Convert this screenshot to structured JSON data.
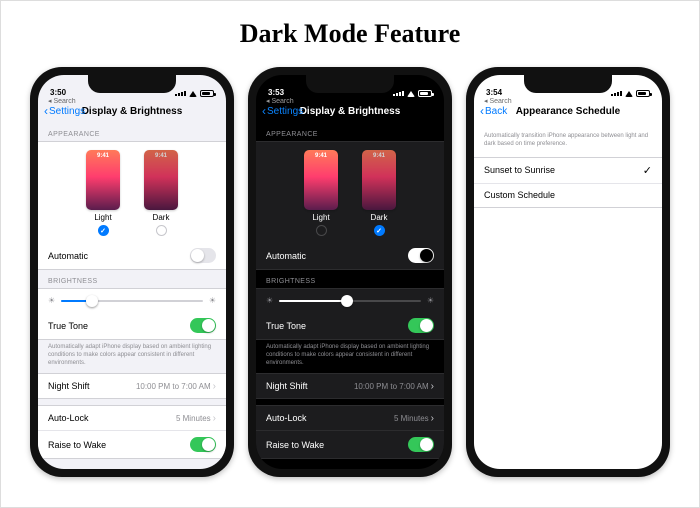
{
  "page_title": "Dark Mode Feature",
  "phones": {
    "light": {
      "time": "3:50",
      "back_crumb": "Search",
      "nav_back": "Settings",
      "nav_title": "Display & Brightness",
      "section_appearance": "APPEARANCE",
      "opt_light_label": "Light",
      "opt_dark_label": "Dark",
      "mini_time": "9:41",
      "selected": "light",
      "row_automatic": "Automatic",
      "automatic_on": false,
      "section_brightness": "BRIGHTNESS",
      "brightness_percent": 22,
      "row_truetone": "True Tone",
      "truetone_on": true,
      "truetone_footer": "Automatically adapt iPhone display based on ambient lighting conditions to make colors appear consistent in different environments.",
      "row_nightshift": "Night Shift",
      "nightshift_value": "10:00 PM to 7:00 AM",
      "row_autolock": "Auto-Lock",
      "autolock_value": "5 Minutes",
      "row_raise": "Raise to Wake",
      "raise_on": true
    },
    "dark": {
      "time": "3:53",
      "back_crumb": "Search",
      "nav_back": "Settings",
      "nav_title": "Display & Brightness",
      "section_appearance": "APPEARANCE",
      "opt_light_label": "Light",
      "opt_dark_label": "Dark",
      "mini_time": "9:41",
      "selected": "dark",
      "row_automatic": "Automatic",
      "automatic_on": true,
      "section_brightness": "BRIGHTNESS",
      "brightness_percent": 48,
      "row_truetone": "True Tone",
      "truetone_on": true,
      "truetone_footer": "Automatically adapt iPhone display based on ambient lighting conditions to make colors appear consistent in different environments.",
      "row_nightshift": "Night Shift",
      "nightshift_value": "10:00 PM to 7:00 AM",
      "row_autolock": "Auto-Lock",
      "autolock_value": "5 Minutes",
      "row_raise": "Raise to Wake",
      "raise_on": true
    },
    "schedule": {
      "time": "3:54",
      "back_crumb": "Search",
      "nav_back": "Back",
      "nav_title": "Appearance Schedule",
      "header_note": "Automatically transition iPhone appearance between light and dark based on time preference.",
      "row_sunset": "Sunset to Sunrise",
      "row_custom": "Custom Schedule",
      "selected": "sunset"
    }
  }
}
